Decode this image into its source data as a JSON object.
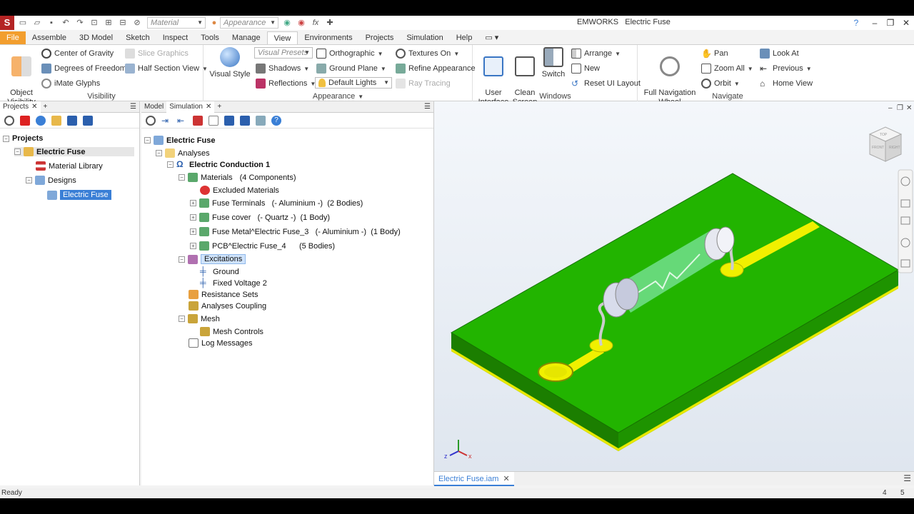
{
  "titlebar": {
    "app_title": "EMWORKS",
    "doc_title": "Electric Fuse",
    "material_placeholder": "Material",
    "appearance_placeholder": "Appearance"
  },
  "menu": {
    "tabs": [
      "File",
      "Assemble",
      "3D Model",
      "Sketch",
      "Inspect",
      "Tools",
      "Manage",
      "View",
      "Environments",
      "Projects",
      "Simulation",
      "Help"
    ],
    "active": "View"
  },
  "ribbon": {
    "visibility": {
      "label": "Visibility",
      "object_visibility": "Object\nVisibility",
      "center_of_gravity": "Center of Gravity",
      "degrees_of_freedom": "Degrees of Freedom",
      "imate_glyphs": "iMate Glyphs",
      "slice_graphics": "Slice Graphics",
      "half_section_view": "Half Section View"
    },
    "appearance": {
      "label": "Appearance",
      "visual_style": "Visual Style",
      "visual_presets": "Visual Presets",
      "shadows": "Shadows",
      "reflections": "Reflections",
      "orthographic": "Orthographic",
      "ground_plane": "Ground Plane",
      "default_lights": "Default Lights",
      "textures_on": "Textures On",
      "refine_appearance": "Refine Appearance",
      "ray_tracing": "Ray Tracing"
    },
    "windows": {
      "label": "Windows",
      "user_interface": "User\nInterface",
      "clean_screen": "Clean\nScreen",
      "switch": "Switch",
      "arrange": "Arrange",
      "new": "New",
      "reset_ui_layout": "Reset UI Layout"
    },
    "navigate": {
      "label": "Navigate",
      "full_navigation_wheel": "Full Navigation\nWheel",
      "pan": "Pan",
      "zoom_all": "Zoom All",
      "orbit": "Orbit",
      "look_at": "Look At",
      "previous": "Previous",
      "home_view": "Home View"
    }
  },
  "projects_panel": {
    "tab": "Projects",
    "tree": {
      "root": "Projects",
      "project": "Electric Fuse",
      "material_library": "Material Library",
      "designs": "Designs",
      "design_item": "Electric Fuse"
    }
  },
  "sim_panel": {
    "tabs": [
      "Model",
      "Simulation"
    ],
    "tree": {
      "root": "Electric Fuse",
      "analyses": "Analyses",
      "study": "Electric Conduction 1",
      "materials": "Materials",
      "materials_count": "(4 Components)",
      "excluded_materials": "Excluded Materials",
      "components": [
        {
          "name": "Fuse Terminals",
          "material": "(- Aluminium -)",
          "bodies": "(2 Bodies)"
        },
        {
          "name": "Fuse cover",
          "material": "(- Quartz -)",
          "bodies": "(1 Body)"
        },
        {
          "name": "Fuse Metal^Electric Fuse_3",
          "material": "(- Aluminium -)",
          "bodies": "(1 Body)"
        },
        {
          "name": "PCB^Electric Fuse_4",
          "material": "",
          "bodies": "(5 Bodies)"
        }
      ],
      "excitations": "Excitations",
      "ground": "Ground",
      "fixed_voltage": "Fixed Voltage 2",
      "resistance_sets": "Resistance Sets",
      "analyses_coupling": "Analyses Coupling",
      "mesh": "Mesh",
      "mesh_controls": "Mesh Controls",
      "log_messages": "Log Messages"
    }
  },
  "viewport": {
    "doc_tab": "Electric Fuse.iam",
    "viewcube_labels": [
      "TOP",
      "FRONT",
      "RIGHT"
    ],
    "axis_labels": {
      "x": "x",
      "y": "y",
      "z": "z"
    }
  },
  "statusbar": {
    "status": "Ready",
    "count_a": "4",
    "count_b": "5"
  },
  "colors": {
    "pcb_green": "#22b400",
    "trace_yellow": "#f0f000",
    "file_orange": "#f29e2e",
    "selection_blue": "#3a7fd6"
  }
}
